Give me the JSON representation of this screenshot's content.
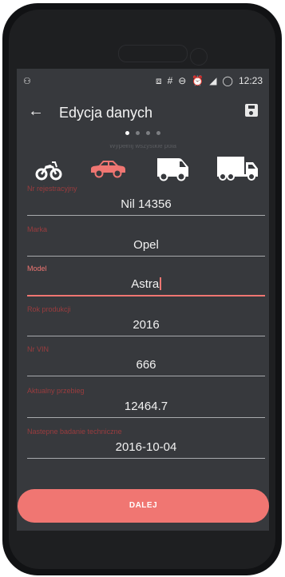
{
  "status_bar": {
    "time": "12:23",
    "icons": [
      "accessibility-icon",
      "cast-icon",
      "hash-icon",
      "dnd-icon",
      "alarm-icon",
      "signal-icon",
      "sync-icon"
    ]
  },
  "appbar": {
    "title": "Edycja danych",
    "back_icon": "arrow-left-icon",
    "save_icon": "save-icon"
  },
  "pager": {
    "total": 4,
    "active": 0
  },
  "hint_text": "Wypełnij wszystkie pola",
  "vehicle_types": [
    {
      "name": "motorcycle",
      "selected": false
    },
    {
      "name": "car",
      "selected": true
    },
    {
      "name": "van",
      "selected": false
    },
    {
      "name": "truck",
      "selected": false
    }
  ],
  "fields": [
    {
      "label": "Nr rejestracyjny",
      "value": "Nil 14356",
      "focused": false
    },
    {
      "label": "Marka",
      "value": "Opel",
      "focused": false
    },
    {
      "label": "Model",
      "value": "Astra",
      "focused": true
    },
    {
      "label": "Rok produkcji",
      "value": "2016",
      "focused": false
    },
    {
      "label": "Nr VIN",
      "value": "666",
      "focused": false
    },
    {
      "label": "Aktualny przebieg",
      "value": "12464.7",
      "focused": false
    },
    {
      "label": "Nastepne badanie techniczne",
      "value": "2016-10-04",
      "focused": false
    }
  ],
  "button": {
    "label": "DALEJ"
  },
  "colors": {
    "accent": "#f07672",
    "background": "#37393d",
    "label_dim": "#9a3c3e"
  }
}
